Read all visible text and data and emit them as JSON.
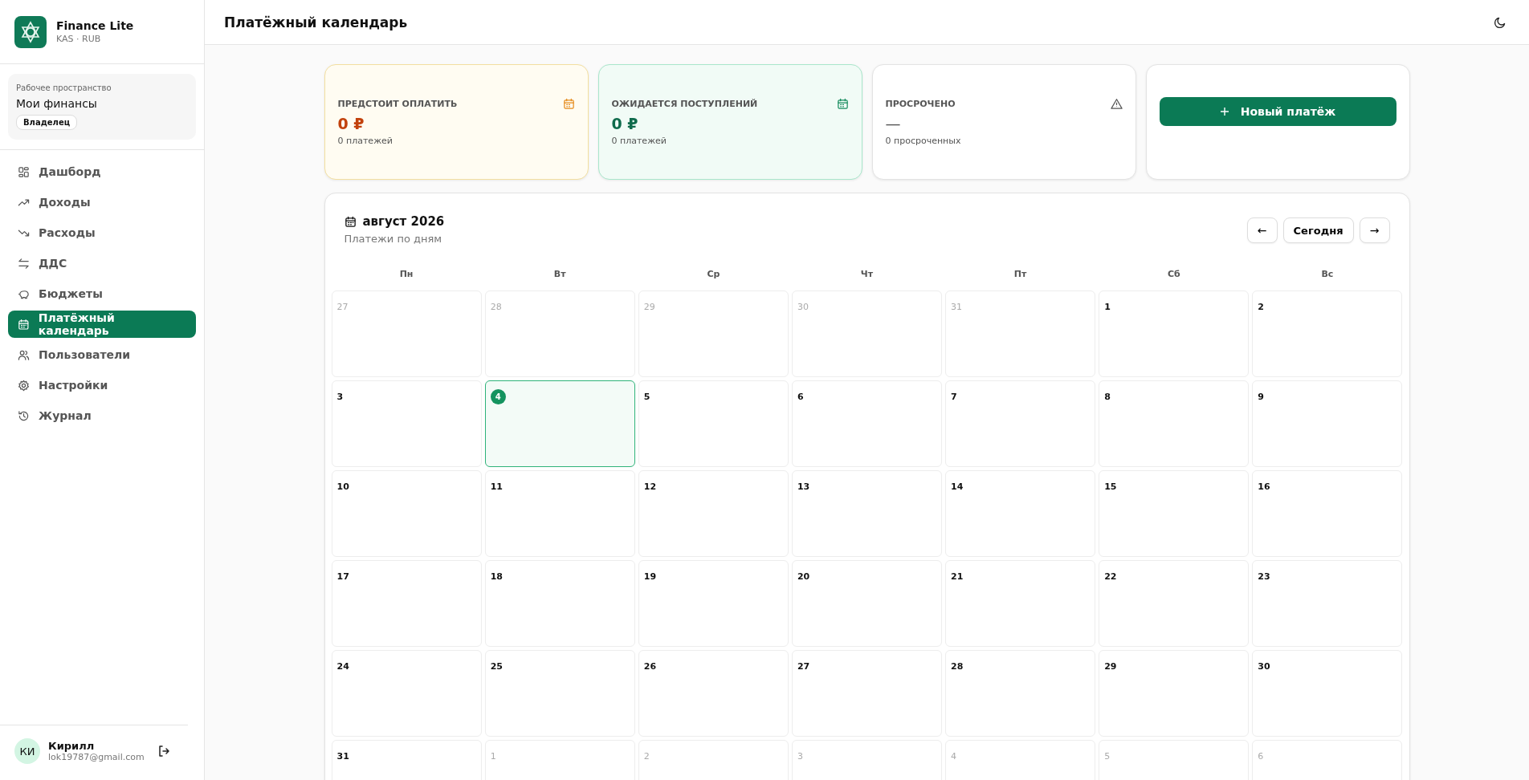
{
  "app": {
    "name": "Finance Lite",
    "subtitle": "KAS · RUB"
  },
  "workspace": {
    "caption": "Рабочее пространство",
    "name": "Мои финансы",
    "role": "Владелец"
  },
  "sidebar": {
    "items": [
      {
        "label": "Дашборд",
        "selected": false
      },
      {
        "label": "Доходы",
        "selected": false
      },
      {
        "label": "Расходы",
        "selected": false
      },
      {
        "label": "ДДС",
        "selected": false
      },
      {
        "label": "Бюджеты",
        "selected": false
      },
      {
        "label": "Платёжный календарь",
        "selected": true
      },
      {
        "label": "Пользователи",
        "selected": false
      },
      {
        "label": "Настройки",
        "selected": false
      },
      {
        "label": "Журнал",
        "selected": false
      }
    ]
  },
  "user": {
    "initials": "КИ",
    "name": "Кирилл",
    "email": "lok19787@gmail.com"
  },
  "page": {
    "title": "Платёжный календарь"
  },
  "stats": [
    {
      "kind": "upcoming",
      "title": "ПРЕДСТОИТ ОПЛАТИТЬ",
      "value": "0 ₽",
      "note": "0 платежей"
    },
    {
      "kind": "incoming",
      "title": "ОЖИДАЕТСЯ ПОСТУПЛЕНИЙ",
      "value": "0 ₽",
      "note": "0 платежей"
    },
    {
      "kind": "overdue",
      "title": "ПРОСРОЧЕНО",
      "value": "—",
      "note": "0 просроченных"
    }
  ],
  "new_payment_button": {
    "label": "Новый платёж"
  },
  "calendar": {
    "month": "август 2026",
    "subtitle": "Платежи по дням",
    "prev": "←",
    "today_button": "Сегодня",
    "next": "→",
    "weekdays": [
      "Пн",
      "Вт",
      "Ср",
      "Чт",
      "Пт",
      "Сб",
      "Вс"
    ],
    "weeks": [
      [
        {
          "day": "27",
          "in_month": false,
          "today": false
        },
        {
          "day": "28",
          "in_month": false,
          "today": false
        },
        {
          "day": "29",
          "in_month": false,
          "today": false
        },
        {
          "day": "30",
          "in_month": false,
          "today": false
        },
        {
          "day": "31",
          "in_month": false,
          "today": false
        },
        {
          "day": "1",
          "in_month": true,
          "today": false
        },
        {
          "day": "2",
          "in_month": true,
          "today": false
        }
      ],
      [
        {
          "day": "3",
          "in_month": true,
          "today": false
        },
        {
          "day": "4",
          "in_month": true,
          "today": true
        },
        {
          "day": "5",
          "in_month": true,
          "today": false
        },
        {
          "day": "6",
          "in_month": true,
          "today": false
        },
        {
          "day": "7",
          "in_month": true,
          "today": false
        },
        {
          "day": "8",
          "in_month": true,
          "today": false
        },
        {
          "day": "9",
          "in_month": true,
          "today": false
        }
      ],
      [
        {
          "day": "10",
          "in_month": true,
          "today": false
        },
        {
          "day": "11",
          "in_month": true,
          "today": false
        },
        {
          "day": "12",
          "in_month": true,
          "today": false
        },
        {
          "day": "13",
          "in_month": true,
          "today": false
        },
        {
          "day": "14",
          "in_month": true,
          "today": false
        },
        {
          "day": "15",
          "in_month": true,
          "today": false
        },
        {
          "day": "16",
          "in_month": true,
          "today": false
        }
      ],
      [
        {
          "day": "17",
          "in_month": true,
          "today": false
        },
        {
          "day": "18",
          "in_month": true,
          "today": false
        },
        {
          "day": "19",
          "in_month": true,
          "today": false
        },
        {
          "day": "20",
          "in_month": true,
          "today": false
        },
        {
          "day": "21",
          "in_month": true,
          "today": false
        },
        {
          "day": "22",
          "in_month": true,
          "today": false
        },
        {
          "day": "23",
          "in_month": true,
          "today": false
        }
      ],
      [
        {
          "day": "24",
          "in_month": true,
          "today": false
        },
        {
          "day": "25",
          "in_month": true,
          "today": false
        },
        {
          "day": "26",
          "in_month": true,
          "today": false
        },
        {
          "day": "27",
          "in_month": true,
          "today": false
        },
        {
          "day": "28",
          "in_month": true,
          "today": false
        },
        {
          "day": "29",
          "in_month": true,
          "today": false
        },
        {
          "day": "30",
          "in_month": true,
          "today": false
        }
      ],
      [
        {
          "day": "31",
          "in_month": true,
          "today": false
        },
        {
          "day": "1",
          "in_month": false,
          "today": false
        },
        {
          "day": "2",
          "in_month": false,
          "today": false
        },
        {
          "day": "3",
          "in_month": false,
          "today": false
        },
        {
          "day": "4",
          "in_month": false,
          "today": false
        },
        {
          "day": "5",
          "in_month": false,
          "today": false
        },
        {
          "day": "6",
          "in_month": false,
          "today": false
        }
      ]
    ]
  }
}
